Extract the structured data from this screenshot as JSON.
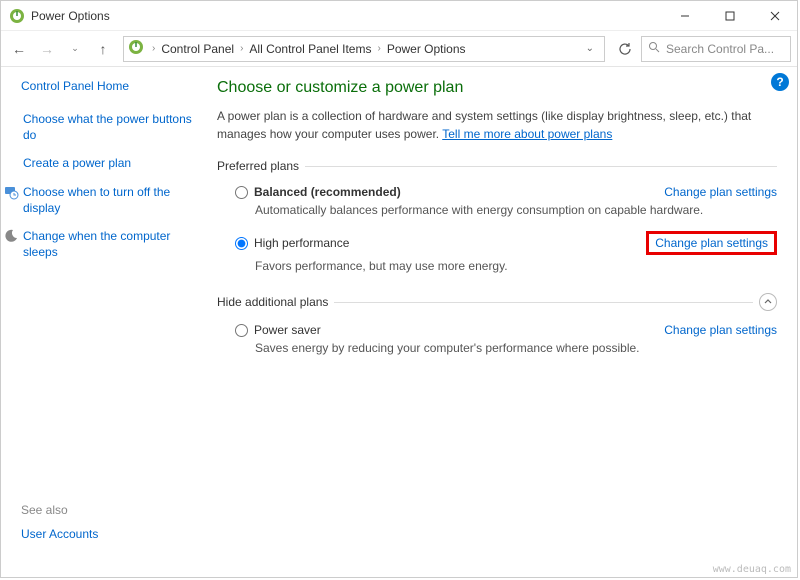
{
  "window": {
    "title": "Power Options"
  },
  "toolbar": {
    "breadcrumbs": [
      "Control Panel",
      "All Control Panel Items",
      "Power Options"
    ],
    "search_placeholder": "Search Control Pa..."
  },
  "sidebar": {
    "home": "Control Panel Home",
    "items": [
      {
        "label": "Choose what the power buttons do",
        "icon": null
      },
      {
        "label": "Create a power plan",
        "icon": null
      },
      {
        "label": "Choose when to turn off the display",
        "icon": "monitor-clock-icon"
      },
      {
        "label": "Change when the computer sleeps",
        "icon": "moon-icon"
      }
    ],
    "see_also": "See also",
    "user_accounts": "User Accounts"
  },
  "main": {
    "heading": "Choose or customize a power plan",
    "intro_text": "A power plan is a collection of hardware and system settings (like display brightness, sleep, etc.) that manages how your computer uses power. ",
    "intro_link": "Tell me more about power plans",
    "preferred_label": "Preferred plans",
    "plans": [
      {
        "name": "Balanced (recommended)",
        "desc": "Automatically balances performance with energy consumption on capable hardware.",
        "selected": false,
        "link": "Change plan settings",
        "highlight": false
      },
      {
        "name": "High performance",
        "desc": "Favors performance, but may use more energy.",
        "selected": true,
        "link": "Change plan settings",
        "highlight": true
      }
    ],
    "hidden_label": "Hide additional plans",
    "hidden_plans": [
      {
        "name": "Power saver",
        "desc": "Saves energy by reducing your computer's performance where possible.",
        "selected": false,
        "link": "Change plan settings"
      }
    ]
  },
  "watermark": "www.deuaq.com"
}
